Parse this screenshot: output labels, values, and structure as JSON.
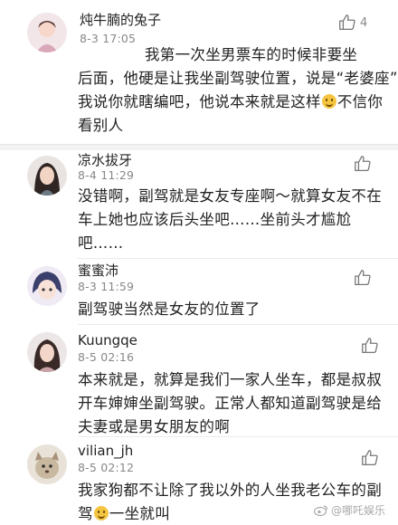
{
  "comments": [
    {
      "username": "炖牛腩的兔子",
      "time": "8-3 17:05",
      "likes": "4",
      "lines": [
        "我第一次坐男票车的时候非要坐",
        "后面，他硬是让我坐副驾驶位置，说是“老婆座”",
        "我说你就瞎编吧，他说本来就是这样",
        "看别人"
      ],
      "line3_tail": "不信你",
      "avatar_icon": "avatar-girl-icon"
    },
    {
      "username": "凉水拔牙",
      "time": "8-4 11:29",
      "likes": "",
      "lines": [
        "没错啊，副驾就是女友专座啊～就算女友不在",
        "车上她也应该后头坐吧……坐前头才尴尬",
        "吧……"
      ],
      "avatar_icon": "avatar-woman-icon"
    },
    {
      "username": "蜜蜜沛",
      "time": "8-3 11:59",
      "likes": "",
      "lines": [
        "副驾驶当然是女友的位置了"
      ],
      "avatar_icon": "avatar-cartoon-icon"
    },
    {
      "username": "Kuungqe",
      "time": "8-5 02:16",
      "likes": "",
      "lines": [
        "本来就是，就算是我们一家人坐车，都是叔叔",
        "开车婶婶坐副驾驶。正常人都知道副驾驶是给",
        "夫妻或是男女朋友的啊"
      ],
      "avatar_icon": "avatar-woman-icon"
    },
    {
      "username": "vilian_jh",
      "time": "8-5 02:12",
      "likes": "",
      "lines": [
        "我家狗都不让除了我以外的人坐我老公车的副",
        "驾"
      ],
      "line2_tail": "一坐就叫",
      "avatar_icon": "avatar-pet-icon"
    }
  ],
  "watermark": "@哪吒娱乐",
  "colors": {
    "text": "#222222",
    "meta": "#888888",
    "divider": "#ebebeb",
    "gap": "#f2f2f2"
  }
}
